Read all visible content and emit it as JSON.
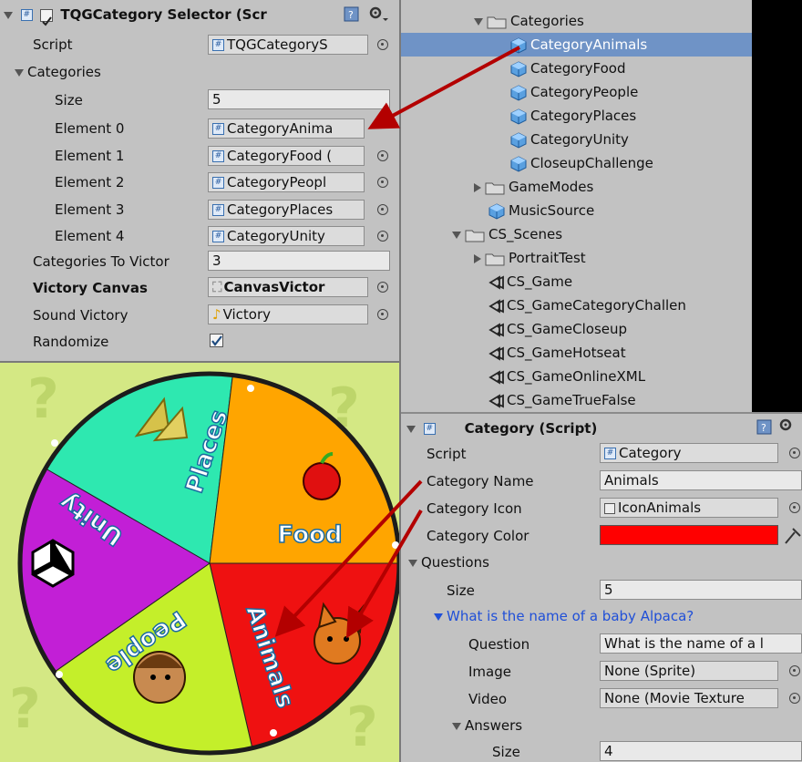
{
  "top_inspector": {
    "title": "TQGCategory Selector (Scr",
    "script_label": "Script",
    "script_value": "TQGCategoryS",
    "categories_label": "Categories",
    "size_label": "Size",
    "size_value": "5",
    "elements": [
      {
        "label": "Element 0",
        "value": "CategoryAnima"
      },
      {
        "label": "Element 1",
        "value": "CategoryFood ("
      },
      {
        "label": "Element 2",
        "value": "CategoryPeopl"
      },
      {
        "label": "Element 3",
        "value": "CategoryPlaces"
      },
      {
        "label": "Element 4",
        "value": "CategoryUnity"
      }
    ],
    "victory_label": "Categories To Victor",
    "victory_value": "3",
    "canvas_label": "Victory Canvas",
    "canvas_value": "CanvasVictor",
    "sound_label": "Sound Victory",
    "sound_value": "Victory",
    "randomize_label": "Randomize",
    "randomize_checked": true
  },
  "hierarchy": {
    "items": [
      {
        "label": "Categories",
        "type": "folder",
        "expanded": true
      },
      {
        "label": "CategoryAnimals",
        "type": "cube",
        "selected": true
      },
      {
        "label": "CategoryFood",
        "type": "cube"
      },
      {
        "label": "CategoryPeople",
        "type": "cube"
      },
      {
        "label": "CategoryPlaces",
        "type": "cube"
      },
      {
        "label": "CategoryUnity",
        "type": "cube"
      },
      {
        "label": "CloseupChallenge",
        "type": "cube"
      },
      {
        "label": "GameModes",
        "type": "folder",
        "expanded": false
      },
      {
        "label": "MusicSource",
        "type": "cube"
      },
      {
        "label": "CS_Scenes",
        "type": "folder",
        "expanded": true
      },
      {
        "label": "PortraitTest",
        "type": "folder",
        "expanded": false
      },
      {
        "label": "CS_Game",
        "type": "scene"
      },
      {
        "label": "CS_GameCategoryChallen",
        "type": "scene"
      },
      {
        "label": "CS_GameCloseup",
        "type": "scene"
      },
      {
        "label": "CS_GameHotseat",
        "type": "scene"
      },
      {
        "label": "CS_GameOnlineXML",
        "type": "scene"
      },
      {
        "label": "CS_GameTrueFalse",
        "type": "scene"
      }
    ]
  },
  "bottom_inspector": {
    "title": "Category (Script)",
    "script_label": "Script",
    "script_value": "Category",
    "name_label": "Category Name",
    "name_value": "Animals",
    "icon_label": "Category Icon",
    "icon_value": "IconAnimals",
    "color_label": "Category Color",
    "color_value": "#ff0000",
    "questions_label": "Questions",
    "size_label": "Size",
    "size_value": "5",
    "question_header": "What is the name of a baby Alpaca?",
    "question_label": "Question",
    "question_value": "What is the name of a l",
    "image_label": "Image",
    "image_value": "None (Sprite)",
    "video_label": "Video",
    "video_value": "None (Movie Texture",
    "answers_label": "Answers",
    "answers_size_label": "Size",
    "answers_size_value": "4"
  },
  "wheel": {
    "segments": [
      "Places",
      "Food",
      "Animals",
      "People",
      "Unity"
    ],
    "colors": {
      "places": "#2ee8b0",
      "food": "#ffa500",
      "animals": "#ef1111",
      "people": "#c4ef2a",
      "unity": "#c21fd6"
    }
  }
}
